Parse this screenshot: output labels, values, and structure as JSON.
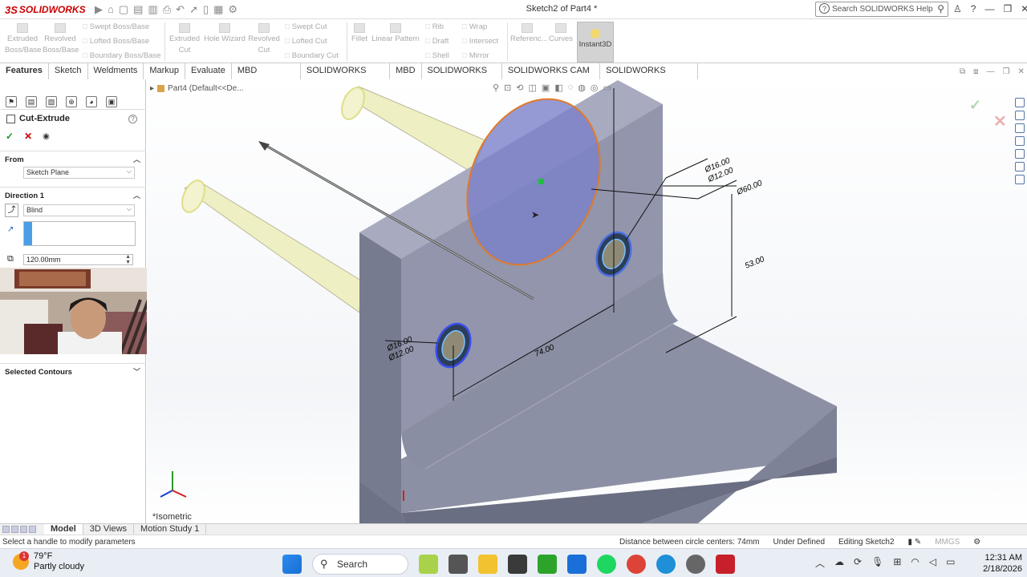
{
  "app": {
    "logo": "SOLIDWORKS",
    "window_title": "Sketch2 of Part4 *",
    "search_placeholder": "Search SOLIDWORKS Help"
  },
  "ribbon": {
    "extruded_boss": "Extruded Boss/Base",
    "revolved_boss": "Revolved Boss/Base",
    "swept_boss": "Swept Boss/Base",
    "lofted_boss": "Lofted Boss/Base",
    "boundary_boss": "Boundary Boss/Base",
    "extruded_cut": "Extruded Cut",
    "hole_wizard": "Hole Wizard",
    "revolved_cut": "Revolved Cut",
    "swept_cut": "Swept Cut",
    "lofted_cut": "Lofted Cut",
    "boundary_cut": "Boundary Cut",
    "fillet": "Fillet",
    "linear_pattern": "Linear Pattern",
    "rib": "Rib",
    "draft": "Draft",
    "shell": "Shell",
    "wrap": "Wrap",
    "intersect": "Intersect",
    "mirror": "Mirror",
    "reference": "Referenc...",
    "curves": "Curves",
    "instant3d": "Instant3D"
  },
  "command_tabs": [
    "Features",
    "Sketch",
    "Weldments",
    "Markup",
    "Evaluate",
    "MBD Dimensions",
    "SOLIDWORKS Add-Ins",
    "MBD",
    "SOLIDWORKS CAM",
    "SOLIDWORKS CAM TBM",
    "SOLIDWORKS Inspection"
  ],
  "property_manager": {
    "title": "Cut-Extrude",
    "from_label": "From",
    "from_value": "Sketch Plane",
    "dir1_label": "Direction 1",
    "end_condition": "Blind",
    "depth": "120.00mm",
    "selected_contours": "Selected Contours"
  },
  "viewport": {
    "breadcrumb": "Part4  (Default<<De...",
    "view_name": "*Isometric",
    "dims": {
      "d1_outer": "Ø16.00",
      "d1_inner": "Ø12.00",
      "d2_outer": "Ø16.00",
      "d2_inner": "Ø12.00",
      "large": "Ø60.00",
      "height": "53.00",
      "spacing": "74.00"
    }
  },
  "bottom_tabs": [
    "Model",
    "3D Views",
    "Motion Study 1"
  ],
  "status": {
    "left": "Select a handle to modify parameters",
    "distance": "Distance between circle centers: 74mm",
    "state": "Under Defined",
    "editing": "Editing Sketch2",
    "units": "MMGS"
  },
  "taskbar": {
    "temp": "79°F",
    "weather": "Partly cloudy",
    "badge": "1",
    "search": "Search",
    "time": "12:31 AM",
    "date": "2/18/2026"
  },
  "colors": {
    "part_face": "#8b8fa3",
    "cylinder": "#efefc4",
    "sketch_circle": "#7a7fc9",
    "highlight": "#e07a2a"
  }
}
